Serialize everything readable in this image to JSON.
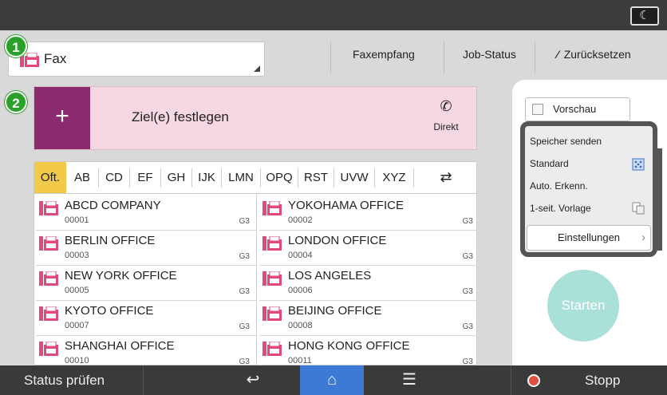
{
  "header": {
    "function_label": "Fax",
    "fax_receive": "Faxempfang",
    "job_status": "Job-Status",
    "reset": "Zurücksetzen",
    "reset_icon": "double-slash-icon",
    "moon_icon": "☾"
  },
  "badges": {
    "one": "1",
    "two": "2"
  },
  "destination": {
    "plus": "+",
    "label": "Ziel(e) festlegen",
    "direct": "Direkt",
    "direct_icon": "✆"
  },
  "tabs": [
    "Oft.",
    "AB",
    "CD",
    "EF",
    "GH",
    "IJK",
    "LMN",
    "OPQ",
    "RST",
    "UVW",
    "XYZ"
  ],
  "address_book": [
    {
      "name": "ABCD COMPANY",
      "number": "00001",
      "mode": "G3"
    },
    {
      "name": "YOKOHAMA OFFICE",
      "number": "00002",
      "mode": "G3"
    },
    {
      "name": "BERLIN OFFICE",
      "number": "00003",
      "mode": "G3"
    },
    {
      "name": "LONDON OFFICE",
      "number": "00004",
      "mode": "G3"
    },
    {
      "name": "NEW YORK OFFICE",
      "number": "00005",
      "mode": "G3"
    },
    {
      "name": "LOS ANGELES",
      "number": "00006",
      "mode": "G3"
    },
    {
      "name": "KYOTO OFFICE",
      "number": "00007",
      "mode": "G3"
    },
    {
      "name": "BEIJING OFFICE",
      "number": "00008",
      "mode": "G3"
    },
    {
      "name": "SHANGHAI  OFFICE",
      "number": "00010",
      "mode": "G3"
    },
    {
      "name": "HONG KONG OFFICE",
      "number": "00011",
      "mode": "G3"
    }
  ],
  "settings": {
    "preview": "Vorschau",
    "memory_send": "Speicher senden",
    "standard": "Standard",
    "auto_detect": "Auto. Erkenn.",
    "one_sided": "1-seit. Vorlage",
    "settings_button": "Einstellungen",
    "start": "Starten"
  },
  "bottom": {
    "status": "Status prüfen",
    "back": "↩",
    "home": "⌂",
    "menu": "☰",
    "stop": "Stopp"
  },
  "colors": {
    "badge": "#2aa12a",
    "destination_bg": "#f6d8e3",
    "plus_bg": "#8a2b6e",
    "active_tab": "#f3c94a",
    "home_button": "#3d7ad6",
    "start_button": "#a9e0d8",
    "stop_dot": "#e0503f"
  }
}
